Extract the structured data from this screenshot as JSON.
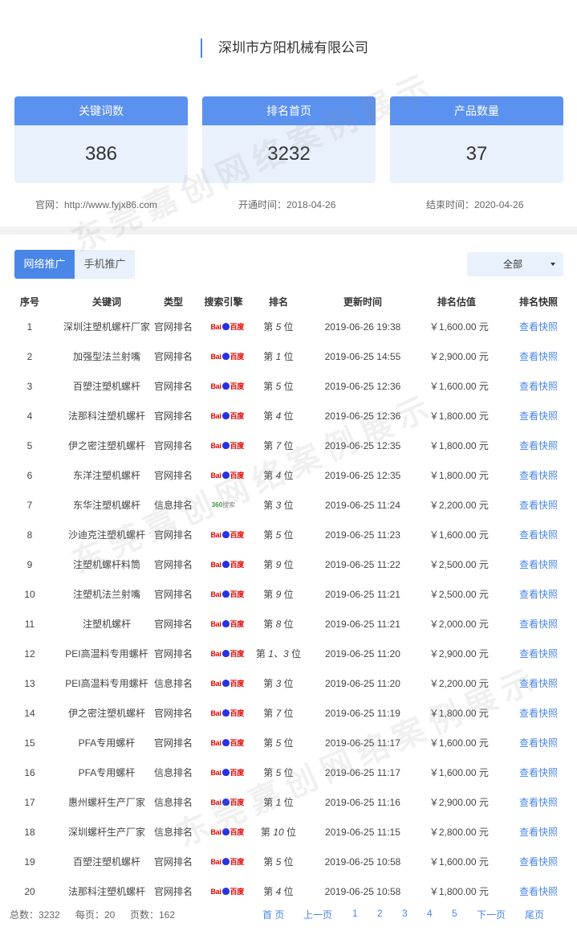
{
  "company": "深圳市方阳机械有限公司",
  "stats": [
    {
      "label": "关键词数",
      "value": "386"
    },
    {
      "label": "排名首页",
      "value": "3232"
    },
    {
      "label": "产品数量",
      "value": "37"
    }
  ],
  "meta": {
    "site": "官网：http://www.fyjx86.com",
    "start": "开通时间：2018-04-26",
    "end": "结束时间：2020-04-26"
  },
  "tabs": [
    "网络推广",
    "手机推广"
  ],
  "filter": {
    "selected": "全部"
  },
  "table": {
    "headers": [
      "序号",
      "关键词",
      "类型",
      "搜索引擎",
      "排名",
      "更新时间",
      "排名估值",
      "排名快照"
    ],
    "snapshot_label": "查看快照",
    "rows": [
      {
        "no": "1",
        "keyword": "深圳注塑机螺杆厂家",
        "type": "官网排名",
        "engine": "baidu",
        "rank_prefix": "第",
        "rank": "5",
        "rank_suffix": "位",
        "time": "2019-06-26 19:38",
        "value": "￥1,600.00 元"
      },
      {
        "no": "2",
        "keyword": "加强型法兰射嘴",
        "type": "官网排名",
        "engine": "baidu",
        "rank_prefix": "第",
        "rank": "1",
        "rank_suffix": "位",
        "time": "2019-06-25 14:55",
        "value": "￥2,900.00 元"
      },
      {
        "no": "3",
        "keyword": "百塑注塑机螺杆",
        "type": "官网排名",
        "engine": "baidu",
        "rank_prefix": "第",
        "rank": "5",
        "rank_suffix": "位",
        "time": "2019-06-25 12:36",
        "value": "￥1,600.00 元"
      },
      {
        "no": "4",
        "keyword": "法那科注塑机螺杆",
        "type": "官网排名",
        "engine": "baidu",
        "rank_prefix": "第",
        "rank": "4",
        "rank_suffix": "位",
        "time": "2019-06-25 12:36",
        "value": "￥1,800.00 元"
      },
      {
        "no": "5",
        "keyword": "伊之密注塑机螺杆",
        "type": "官网排名",
        "engine": "baidu",
        "rank_prefix": "第",
        "rank": "7",
        "rank_suffix": "位",
        "time": "2019-06-25 12:35",
        "value": "￥1,800.00 元"
      },
      {
        "no": "6",
        "keyword": "东洋注塑机螺杆",
        "type": "官网排名",
        "engine": "baidu",
        "rank_prefix": "第",
        "rank": "4",
        "rank_suffix": "位",
        "time": "2019-06-25 12:35",
        "value": "￥1,800.00 元"
      },
      {
        "no": "7",
        "keyword": "东华注塑机螺杆",
        "type": "信息排名",
        "engine": "360",
        "rank_prefix": "第",
        "rank": "3",
        "rank_suffix": "位",
        "time": "2019-06-25 11:24",
        "value": "￥2,200.00 元"
      },
      {
        "no": "8",
        "keyword": "沙迪克注塑机螺杆",
        "type": "官网排名",
        "engine": "baidu",
        "rank_prefix": "第",
        "rank": "5",
        "rank_suffix": "位",
        "time": "2019-06-25 11:23",
        "value": "￥1,600.00 元"
      },
      {
        "no": "9",
        "keyword": "注塑机螺杆料筒",
        "type": "官网排名",
        "engine": "baidu",
        "rank_prefix": "第",
        "rank": "9",
        "rank_suffix": "位",
        "time": "2019-06-25 11:22",
        "value": "￥2,500.00 元"
      },
      {
        "no": "10",
        "keyword": "注塑机法兰射嘴",
        "type": "官网排名",
        "engine": "baidu",
        "rank_prefix": "第",
        "rank": "9",
        "rank_suffix": "位",
        "time": "2019-06-25 11:21",
        "value": "￥2,500.00 元"
      },
      {
        "no": "11",
        "keyword": "注塑机螺杆",
        "type": "官网排名",
        "engine": "baidu",
        "rank_prefix": "第",
        "rank": "8",
        "rank_suffix": "位",
        "time": "2019-06-25 11:21",
        "value": "￥2,000.00 元"
      },
      {
        "no": "12",
        "keyword": "PEI高温料专用螺杆",
        "type": "官网排名",
        "engine": "baidu",
        "rank_prefix": "第",
        "rank": "1、3",
        "rank_suffix": "位",
        "time": "2019-06-25 11:20",
        "value": "￥2,900.00 元"
      },
      {
        "no": "13",
        "keyword": "PEI高温料专用螺杆",
        "type": "信息排名",
        "engine": "baidu",
        "rank_prefix": "第",
        "rank": "3",
        "rank_suffix": "位",
        "time": "2019-06-25 11:20",
        "value": "￥2,200.00 元"
      },
      {
        "no": "14",
        "keyword": "伊之密注塑机螺杆",
        "type": "官网排名",
        "engine": "baidu",
        "rank_prefix": "第",
        "rank": "7",
        "rank_suffix": "位",
        "time": "2019-06-25 11:19",
        "value": "￥1,800.00 元"
      },
      {
        "no": "15",
        "keyword": "PFA专用螺杆",
        "type": "官网排名",
        "engine": "baidu",
        "rank_prefix": "第",
        "rank": "5",
        "rank_suffix": "位",
        "time": "2019-06-25 11:17",
        "value": "￥1,600.00 元"
      },
      {
        "no": "16",
        "keyword": "PFA专用螺杆",
        "type": "信息排名",
        "engine": "baidu",
        "rank_prefix": "第",
        "rank": "5",
        "rank_suffix": "位",
        "time": "2019-06-25 11:17",
        "value": "￥1,600.00 元"
      },
      {
        "no": "17",
        "keyword": "惠州螺杆生产厂家",
        "type": "信息排名",
        "engine": "baidu",
        "rank_prefix": "第",
        "rank": "1",
        "rank_suffix": "位",
        "time": "2019-06-25 11:16",
        "value": "￥2,900.00 元"
      },
      {
        "no": "18",
        "keyword": "深圳螺杆生产厂家",
        "type": "信息排名",
        "engine": "baidu",
        "rank_prefix": "第",
        "rank": "10",
        "rank_suffix": "位",
        "time": "2019-06-25 11:15",
        "value": "￥2,800.00 元"
      },
      {
        "no": "19",
        "keyword": "百塑注塑机螺杆",
        "type": "官网排名",
        "engine": "baidu",
        "rank_prefix": "第",
        "rank": "5",
        "rank_suffix": "位",
        "time": "2019-06-25 10:58",
        "value": "￥1,600.00 元"
      },
      {
        "no": "20",
        "keyword": "法那科注塑机螺杆",
        "type": "官网排名",
        "engine": "baidu",
        "rank_prefix": "第",
        "rank": "4",
        "rank_suffix": "位",
        "time": "2019-06-25 10:58",
        "value": "￥1,800.00 元"
      }
    ]
  },
  "engines": {
    "baidu": {
      "text_left": "Bai",
      "text_right": "百度"
    },
    "360": {
      "text_left": "360",
      "text_right": "搜索"
    }
  },
  "footer": {
    "total": "总数：3232",
    "per_page": "每页：20",
    "pages": "页数：162",
    "first": "首 页",
    "prev": "上一页",
    "page_numbers": [
      "1",
      "2",
      "3",
      "4",
      "5"
    ],
    "next": "下一页",
    "last": "尾页"
  },
  "watermark": "东莞嘉创网络案例展示"
}
